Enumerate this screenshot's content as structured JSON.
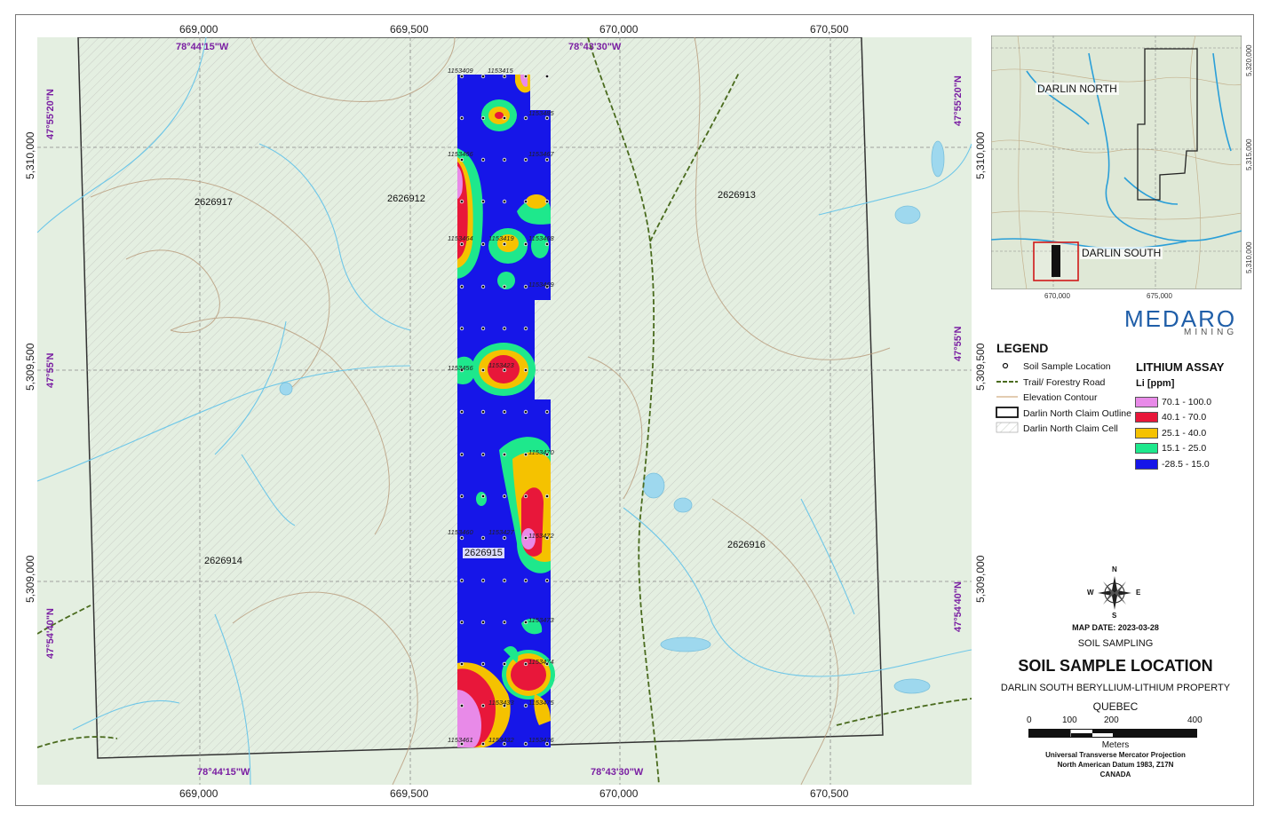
{
  "map": {
    "easting_top": [
      "669,000",
      "669,500",
      "670,000",
      "670,500"
    ],
    "easting_bottom": [
      "669,000",
      "669,500",
      "670,000",
      "670,500"
    ],
    "northing_left": [
      "5,310,000",
      "5,309,500",
      "5,309,000"
    ],
    "northing_right": [
      "5,310,000",
      "5,309,500",
      "5,309,000"
    ],
    "lon_top": [
      "78°44'15\"W",
      "78°43'30\"W"
    ],
    "lon_bottom": [
      "78°44'15\"W",
      "78°43'30\"W"
    ],
    "lat_left": [
      "47°55'20\"N",
      "47°55'N",
      "47°54'40\"N"
    ],
    "lat_right": [
      "47°55'20\"N",
      "47°55'N",
      "47°54'40\"N"
    ],
    "claim_cells": [
      "2626917",
      "2626912",
      "2626913",
      "2626914",
      "2626915",
      "2626916"
    ],
    "sample_ids": [
      "1153409",
      "1153415",
      "1153485",
      "1153466",
      "1153467",
      "1153464",
      "1153419",
      "1153468",
      "1153469",
      "1153456",
      "1153423",
      "1153470",
      "1153460",
      "1153427",
      "1153472",
      "1153473",
      "1153474",
      "1153433",
      "1153475",
      "1153461",
      "1153432",
      "1153476"
    ]
  },
  "inset": {
    "labels": [
      "DARLIN NORTH",
      "DARLIN SOUTH"
    ],
    "x_ticks": [
      "670,000",
      "675,000"
    ],
    "y_ticks": [
      "5,320,000",
      "5,315,000",
      "5,310,000"
    ]
  },
  "logo": {
    "name": "MEDARO",
    "sub": "MINING"
  },
  "legend": {
    "title": "LEGEND",
    "items": [
      "Soil Sample Location",
      "Trail/ Forestry Road",
      "Elevation Contour",
      "Darlin North Claim Outline",
      "Darlin North Claim Cell"
    ],
    "assay_title": "LITHIUM ASSAY",
    "assay_unit": "Li [ppm]",
    "assay_classes": [
      {
        "label": "70.1 - 100.0",
        "color": "#e88ae8"
      },
      {
        "label": "40.1 - 70.0",
        "color": "#e8173a"
      },
      {
        "label": "25.1 - 40.0",
        "color": "#f5c200"
      },
      {
        "label": "15.1 - 25.0",
        "color": "#1ee88c"
      },
      {
        "label": "-28.5 - 15.0",
        "color": "#1616e8"
      }
    ]
  },
  "compass": {
    "n": "N",
    "s": "S",
    "e": "E",
    "w": "W"
  },
  "info": {
    "map_date": "MAP DATE: 2023-03-28",
    "subject": "SOIL SAMPLING",
    "title": "SOIL SAMPLE LOCATION",
    "property": "DARLIN SOUTH BERYLLIUM-LITHIUM PROPERTY",
    "province": "QUEBEC"
  },
  "scale": {
    "ticks": [
      "0",
      "100",
      "200",
      "400"
    ],
    "unit": "Meters",
    "proj1": "Universal Transverse Mercator Projection",
    "proj2": "North American Datum 1983, Z17N",
    "proj3": "CANADA"
  }
}
